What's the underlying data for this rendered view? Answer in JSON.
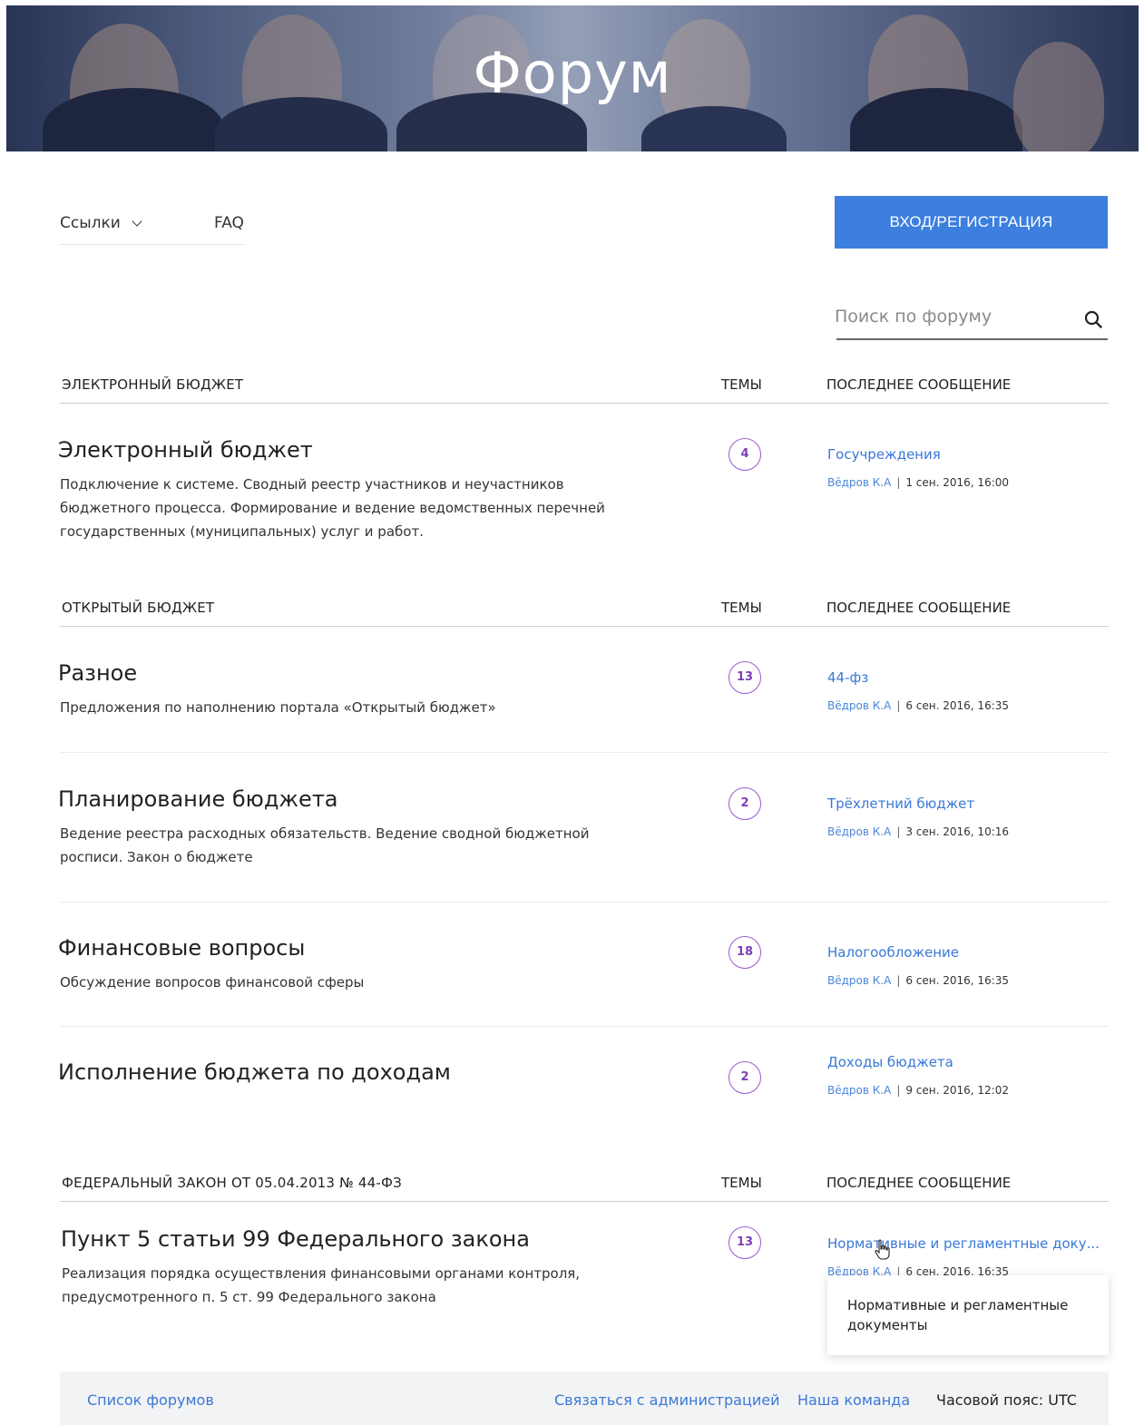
{
  "hero": {
    "title": "Форум"
  },
  "nav": {
    "links_label": "Ссылки",
    "faq_label": "FAQ",
    "login_label": "ВХОД/РЕГИСТРАЦИЯ"
  },
  "search": {
    "placeholder": "Поиск по форуму"
  },
  "sections": [
    {
      "title": "ЭЛЕКТРОННЫЙ БЮДЖЕТ",
      "topics_header": "ТЕМЫ",
      "last_header": "ПОСЛЕДНЕЕ СООБЩЕНИЕ",
      "forums": [
        {
          "title": "Электронный бюджет",
          "description": "Подключение к системе. Сводный реестр участников и неучастников бюджетного процесса. Формирование и ведение ведомственных перечней государственных (муниципальных) услуг и работ.",
          "topics": "4",
          "last_topic": "Госучреждения",
          "last_author": "Вёдров К.А",
          "last_date": "1 сен. 2016, 16:00"
        }
      ]
    },
    {
      "title": "ОТКРЫТЫЙ БЮДЖЕТ",
      "topics_header": "ТЕМЫ",
      "last_header": "ПОСЛЕДНЕЕ СООБЩЕНИЕ",
      "forums": [
        {
          "title": "Разное",
          "description": "Предложения по наполнению портала «Открытый бюджет»",
          "topics": "13",
          "last_topic": "44-фз",
          "last_author": "Вёдров К.А",
          "last_date": "6 сен. 2016, 16:35"
        },
        {
          "title": "Планирование бюджета",
          "description": "Ведение реестра расходных обязательств. Ведение сводной бюджетной росписи. Закон о бюджете",
          "topics": "2",
          "last_topic": "Трёхлетний бюджет",
          "last_author": "Вёдров К.А",
          "last_date": "3 сен. 2016, 10:16"
        },
        {
          "title": "Финансовые вопросы",
          "description": "Обсуждение вопросов финансовой сферы",
          "topics": "18",
          "last_topic": "Налогообложение",
          "last_author": "Вёдров К.А",
          "last_date": "6 сен. 2016, 16:35"
        },
        {
          "title": "Исполнение бюджета по доходам",
          "description": "",
          "topics": "2",
          "last_topic": "Доходы бюджета",
          "last_author": "Вёдров К.А",
          "last_date": "9 сен. 2016, 12:02"
        }
      ]
    },
    {
      "title": "ФЕДЕРАЛЬНЫЙ ЗАКОН ОТ 05.04.2013 № 44-ФЗ",
      "topics_header": "ТЕМЫ",
      "last_header": "ПОСЛЕДНЕЕ СООБЩЕНИЕ",
      "forums": [
        {
          "title": "Пункт 5 статьи 99 Федерального закона",
          "description": "Реализация порядка осуществления финансовыми органами контроля, предусмотренного п. 5 ст. 99 Федерального закона",
          "topics": "13",
          "last_topic": "Нормативные и регламентные доку...",
          "last_author": "Вёдров К.А",
          "last_date": "6 сен. 2016, 16:35"
        }
      ]
    }
  ],
  "tooltip": {
    "text": "Нормативные и регламентные документы"
  },
  "footer": {
    "forum_list": "Список форумов",
    "contact": "Связаться с администрацией",
    "team": "Наша команда",
    "timezone": "Часовой пояс: UTC"
  }
}
